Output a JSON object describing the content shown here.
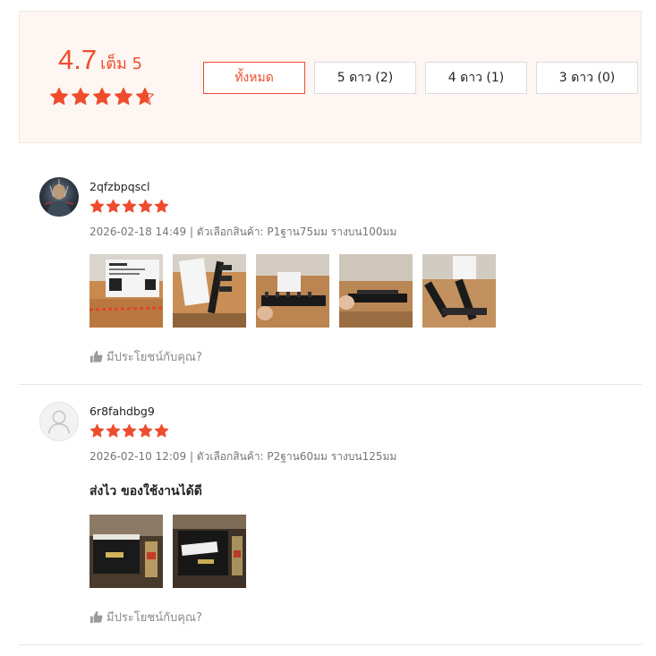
{
  "summary": {
    "score": "4.7",
    "out_of": "เต็ม 5",
    "stars_filled": 4.7,
    "filters": [
      {
        "label": "ทั้งหมด",
        "active": true
      },
      {
        "label": "5 ดาว (2)",
        "active": false
      },
      {
        "label": "4 ดาว (1)",
        "active": false
      },
      {
        "label": "3 ดาว (0)",
        "active": false
      }
    ]
  },
  "reviews": [
    {
      "username": "2qfzbpqscl",
      "stars": 5,
      "meta": "2026-02-18 14:49 | ตัวเลือกสินค้า: P1ฐาน75มม รางบน100มม",
      "comment": "",
      "photo_count": 5,
      "helpful": "มีประโยชน์กับคุณ?"
    },
    {
      "username": "6r8fahdbg9",
      "stars": 5,
      "meta": "2026-02-10 12:09 | ตัวเลือกสินค้า: P2ฐาน60มม รางบน125มม",
      "comment": "ส่งไว ของใช้งานได้ดี",
      "photo_count": 2,
      "helpful": "มีประโยชน์กับคุณ?"
    }
  ],
  "colors": {
    "accent": "#ee4d2d",
    "summary_bg": "#fdf6f2",
    "muted_text": "#757575"
  },
  "icons": {
    "star": "star-icon",
    "thumb": "thumbs-up-icon",
    "default_avatar": "user-icon"
  }
}
